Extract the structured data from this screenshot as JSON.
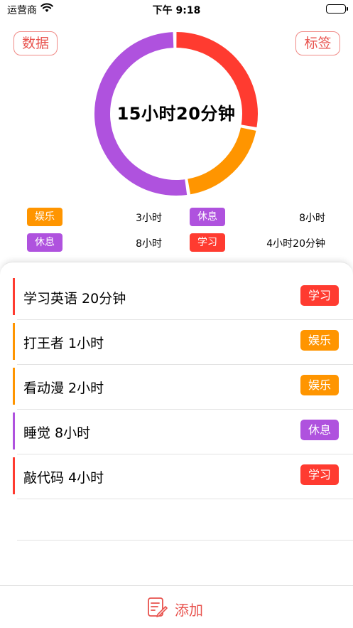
{
  "status_bar": {
    "carrier": "运营商",
    "time": "下午 9:18"
  },
  "header": {
    "data_button": "数据",
    "tags_button": "标签"
  },
  "summary": {
    "total": "15小时20分钟",
    "segments": [
      {
        "category": "学习",
        "color": "#FF3B30",
        "minutes": 260
      },
      {
        "category": "娱乐",
        "color": "#FF9500",
        "minutes": 180
      },
      {
        "category": "休息",
        "color": "#AF52DE",
        "minutes": 480
      }
    ]
  },
  "legend": [
    {
      "tag": "娱乐",
      "color": "#FF9500",
      "value": "3小时"
    },
    {
      "tag": "休息",
      "color": "#AF52DE",
      "value": "8小时"
    },
    {
      "tag": "休息",
      "color": "#AF52DE",
      "value": "8小时"
    },
    {
      "tag": "学习",
      "color": "#FF3B30",
      "value": "4小时20分钟"
    }
  ],
  "entries": [
    {
      "title": "学习英语  20分钟",
      "tag": "学习",
      "color": "#FF3B30"
    },
    {
      "title": "打王者  1小时",
      "tag": "娱乐",
      "color": "#FF9500"
    },
    {
      "title": "看动漫  2小时",
      "tag": "娱乐",
      "color": "#FF9500"
    },
    {
      "title": "睡觉  8小时",
      "tag": "休息",
      "color": "#AF52DE"
    },
    {
      "title": "敲代码  4小时",
      "tag": "学习",
      "color": "#FF3B30"
    }
  ],
  "footer": {
    "add_label": "添加"
  },
  "colors": {
    "accent": "#E8524D",
    "study": "#FF3B30",
    "fun": "#FF9500",
    "rest": "#AF52DE"
  }
}
